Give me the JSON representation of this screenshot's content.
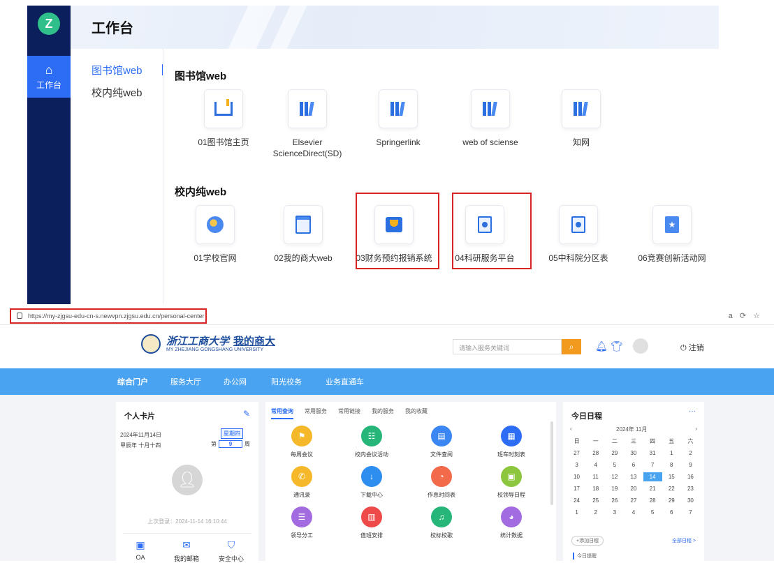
{
  "workbench": {
    "title": "工作台",
    "sidebar": {
      "home_label": "工作台"
    },
    "tabs": [
      "图书馆web",
      "校内纯web"
    ],
    "sections": [
      {
        "title": "图书馆web",
        "items": [
          "01图书馆主页",
          "Elsevier ScienceDirect(SD)",
          "Springerlink",
          "web of sciense",
          "知网"
        ]
      },
      {
        "title": "校内纯web",
        "items": [
          "01学校官网",
          "02我的商大web",
          "03财务预约报销系统",
          "04科研服务平台",
          "05中科院分区表",
          "06竞赛创新活动网"
        ]
      }
    ]
  },
  "browser": {
    "url": "https://my-zjgsu-edu-cn-s.newvpn.zjgsu.edu.cn/personal-center"
  },
  "portal": {
    "logo_text": "浙江工商大学",
    "logo_my": "我的商大",
    "logo_sub": "MY ZHEJIANG GONGSHANG UNIVERSITY",
    "search_placeholder": "请输入服务关键词",
    "logout": "注销",
    "nav": [
      "综合门户",
      "服务大厅",
      "办公网",
      "阳光校务",
      "业务直通车"
    ],
    "card": {
      "title": "个人卡片",
      "date": "2024年11月14日",
      "lunar": "甲辰年 十月十四",
      "weekday": "星期四",
      "week_prefix": "第",
      "week_num": "9",
      "week_suffix": "周",
      "last_login": "上次登录：2024-11-14 16:10:44",
      "links": [
        "OA",
        "我的邮箱",
        "安全中心"
      ]
    },
    "services": {
      "tabs": [
        "常用查询",
        "常用服务",
        "常用链接",
        "我的服务",
        "我的收藏"
      ],
      "items": [
        "每周会议",
        "校内会议活动",
        "文件查阅",
        "班车时刻表",
        "通讯录",
        "下载中心",
        "作息时间表",
        "校领导日程",
        "领导分工",
        "值班安排",
        "校标校歌",
        "统计数据"
      ],
      "colors": [
        "#f5b82a",
        "#27b67a",
        "#3a86f2",
        "#2d6df6",
        "#f5b82a",
        "#2d8ef0",
        "#f26a4a",
        "#8cc63f",
        "#a36be0",
        "#ef4a4a",
        "#27b67a",
        "#a36be0"
      ]
    },
    "calendar": {
      "title": "今日日程",
      "more": "···",
      "year": "2024年",
      "month": "11月",
      "weekdays": [
        "日",
        "一",
        "二",
        "三",
        "四",
        "五",
        "六"
      ],
      "days": [
        "27",
        "28",
        "29",
        "30",
        "31",
        "1",
        "2",
        "3",
        "4",
        "5",
        "6",
        "7",
        "8",
        "9",
        "10",
        "11",
        "12",
        "13",
        "14",
        "15",
        "16",
        "17",
        "18",
        "19",
        "20",
        "21",
        "22",
        "23",
        "24",
        "25",
        "26",
        "27",
        "28",
        "29",
        "30",
        "1",
        "2",
        "3",
        "4",
        "5",
        "6",
        "7"
      ],
      "today": "14",
      "add_plan": "+添加日程",
      "all_plan": "全部日程 >",
      "today_tag": "今日提醒"
    }
  }
}
